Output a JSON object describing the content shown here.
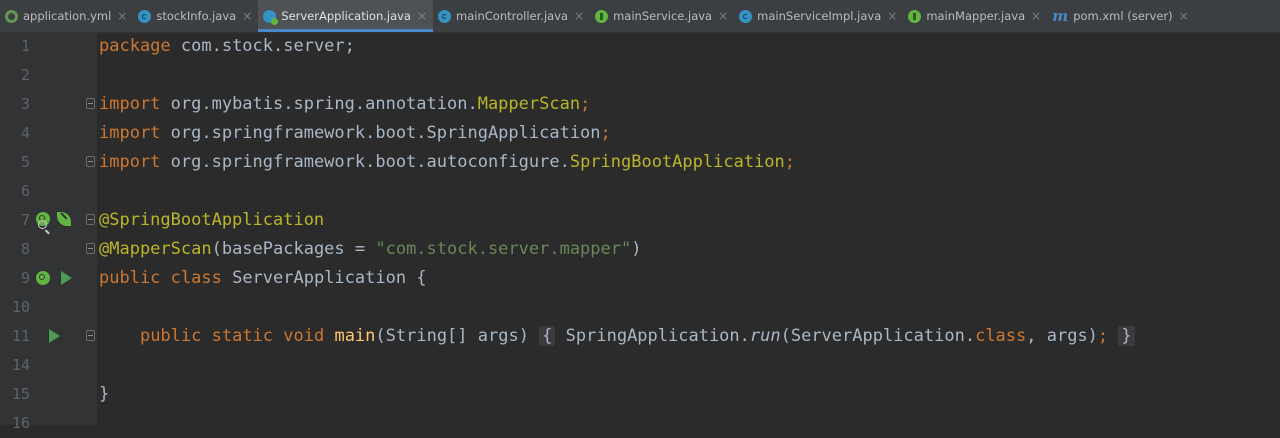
{
  "tabs": [
    {
      "label": "application.yml",
      "icon": "yml-file-icon",
      "active": false
    },
    {
      "label": "stockInfo.java",
      "icon": "class-icon",
      "active": false
    },
    {
      "label": "ServerApplication.java",
      "icon": "spring-boot-class-icon",
      "active": true
    },
    {
      "label": "mainController.java",
      "icon": "class-icon",
      "active": false
    },
    {
      "label": "mainService.java",
      "icon": "interface-icon",
      "active": false
    },
    {
      "label": "mainServiceImpl.java",
      "icon": "class-icon",
      "active": false
    },
    {
      "label": "mainMapper.java",
      "icon": "interface-icon",
      "active": false
    },
    {
      "label": "pom.xml (server)",
      "icon": "maven-icon",
      "active": false
    }
  ],
  "tab_close_glyph": "×",
  "line_numbers": [
    "1",
    "2",
    "3",
    "4",
    "5",
    "6",
    "7",
    "8",
    "9",
    "10",
    "11",
    "14",
    "15",
    "16"
  ],
  "code": {
    "l1": {
      "kw": "package",
      "rest": " com.stock.server;"
    },
    "l3": {
      "kw": "import",
      "path": " org.mybatis.spring.annotation.",
      "cls": "MapperScan",
      "end": ";"
    },
    "l4": {
      "kw": "import",
      "path": " org.springframework.boot.SpringApplication",
      "end": ";"
    },
    "l5": {
      "kw": "import",
      "path": " org.springframework.boot.autoconfigure.",
      "cls": "SpringBootApplication",
      "end": ";"
    },
    "l7": {
      "ann": "@SpringBootApplication"
    },
    "l8": {
      "ann": "@MapperScan",
      "open": "(basePackages = ",
      "str": "\"com.stock.server.mapper\"",
      "close": ")"
    },
    "l9": {
      "kw1": "public",
      "kw2": " class",
      "rest": " ServerApplication {"
    },
    "l11": {
      "kw1": "public",
      "kw2": " static",
      "kw3": " void",
      "fn": " main",
      "sig": "(String[] args) ",
      "lbrace": "{",
      "sp1": " SpringApplication.",
      "run": "run",
      "args1": "(ServerApplication.",
      "kwclass": "class",
      "args2": ", args)",
      "semi": ";",
      "sp2": " ",
      "rbrace": "}"
    },
    "l15": {
      "rest": "}"
    }
  },
  "colors": {
    "editor_bg": "#2b2b2b",
    "gutter_bg": "#313335",
    "keyword": "#cc7832",
    "annotation": "#bbb529",
    "string": "#6a8759",
    "method": "#ffc66d",
    "text": "#a9b7c6",
    "active_tab_underline": "#4a88c7"
  }
}
